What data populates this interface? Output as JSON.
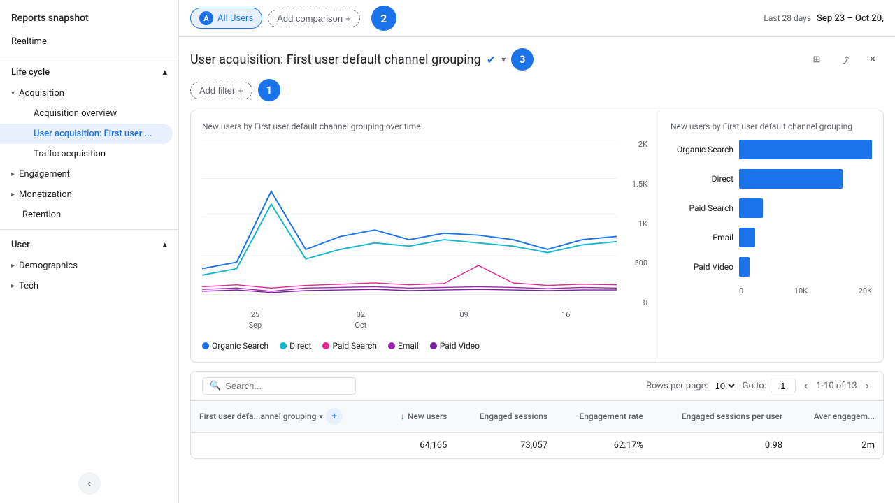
{
  "sidebar": {
    "title": "Reports snapshot",
    "realtime": "Realtime",
    "sections": [
      {
        "name": "life-cycle",
        "label": "Life cycle",
        "expanded": true,
        "items": [
          {
            "name": "acquisition",
            "label": "Acquisition",
            "expanded": true,
            "children": [
              {
                "name": "acquisition-overview",
                "label": "Acquisition overview",
                "active": false
              },
              {
                "name": "user-acquisition",
                "label": "User acquisition: First user ...",
                "active": true
              },
              {
                "name": "traffic-acquisition",
                "label": "Traffic acquisition",
                "active": false
              }
            ]
          },
          {
            "name": "engagement",
            "label": "Engagement",
            "expanded": false
          },
          {
            "name": "monetization",
            "label": "Monetization",
            "expanded": false
          },
          {
            "name": "retention",
            "label": "Retention",
            "expanded": false
          }
        ]
      },
      {
        "name": "user",
        "label": "User",
        "expanded": true,
        "items": [
          {
            "name": "demographics",
            "label": "Demographics",
            "expanded": false
          },
          {
            "name": "tech",
            "label": "Tech",
            "expanded": false
          }
        ]
      }
    ],
    "collapse_label": "Collapse"
  },
  "topbar": {
    "segment": "All Users",
    "segment_icon": "A",
    "add_comparison": "Add comparison",
    "step_badge": "2",
    "last_period_label": "Last 28 days",
    "date_range": "Sep 23 – Oct 20,"
  },
  "page": {
    "title": "User acquisition: First user default channel grouping",
    "step3_badge": "3",
    "add_filter": "Add filter",
    "step1_badge": "1"
  },
  "line_chart": {
    "title": "New users by First user default channel grouping over time",
    "y_labels": [
      "2K",
      "1.5K",
      "1K",
      "500",
      "0"
    ],
    "x_axis": [
      {
        "date": "25",
        "month": "Sep"
      },
      {
        "date": "02",
        "month": "Oct"
      },
      {
        "date": "09",
        "month": ""
      },
      {
        "date": "16",
        "month": ""
      }
    ],
    "legend": [
      {
        "name": "Organic Search",
        "color": "#1a73e8"
      },
      {
        "name": "Direct",
        "color": "#12b5cb"
      },
      {
        "name": "Paid Search",
        "color": "#e52592"
      },
      {
        "name": "Email",
        "color": "#9c27b0"
      },
      {
        "name": "Paid Video",
        "color": "#7b1fa2"
      }
    ]
  },
  "bar_chart": {
    "title": "New users by First user default channel grouping",
    "items": [
      {
        "label": "Organic Search",
        "value": 100,
        "color": "#1a73e8"
      },
      {
        "label": "Direct",
        "value": 78,
        "color": "#1a73e8"
      },
      {
        "label": "Paid Search",
        "value": 18,
        "color": "#1a73e8"
      },
      {
        "label": "Email",
        "value": 12,
        "color": "#1a73e8"
      },
      {
        "label": "Paid Video",
        "value": 8,
        "color": "#1a73e8"
      }
    ],
    "x_labels": [
      "0",
      "10K",
      "20K"
    ]
  },
  "table": {
    "search_placeholder": "Search...",
    "rows_per_page_label": "Rows per page:",
    "rows_per_page_value": "10",
    "goto_label": "Go to:",
    "goto_value": "1",
    "pagination_info": "1-10 of 13",
    "dim_column": "First user defa...annel grouping",
    "columns": [
      {
        "key": "new_users",
        "label": "New users",
        "sortable": true
      },
      {
        "key": "engaged_sessions",
        "label": "Engaged sessions",
        "sortable": false
      },
      {
        "key": "engagement_rate",
        "label": "Engagement rate",
        "sortable": false
      },
      {
        "key": "engaged_sessions_per",
        "label": "Engaged sessions per user",
        "sortable": false
      },
      {
        "key": "avg_engagement",
        "label": "Aver engagem...",
        "sortable": false
      }
    ],
    "rows": [
      {
        "dim": "",
        "new_users": "64,165",
        "engaged_sessions": "73,057",
        "engagement_rate": "62.17%",
        "engaged_sessions_per": "0.98",
        "avg_engagement": "2m"
      }
    ]
  },
  "icons": {
    "chevron_down": "▾",
    "chevron_right": "▸",
    "chevron_up": "▴",
    "chevron_left": "‹",
    "chevron_right_nav": "›",
    "search": "🔍",
    "check_circle": "✓",
    "share": "⤴",
    "table_chart": "⊞",
    "close": "✕",
    "add": "+",
    "sort_down": "↓",
    "expand": "⟩"
  }
}
